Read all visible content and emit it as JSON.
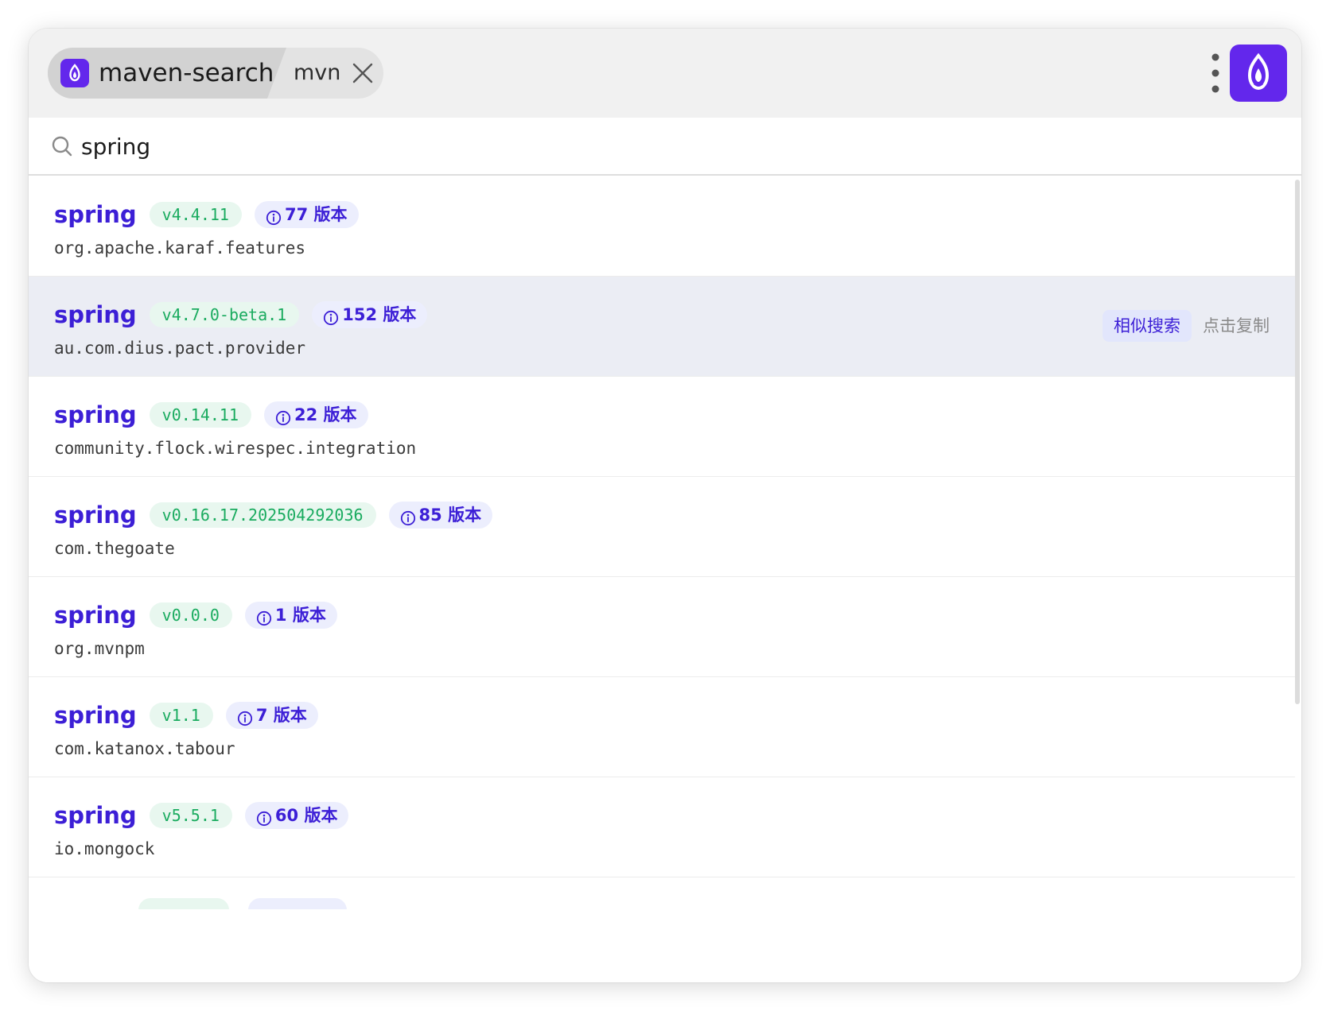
{
  "header": {
    "plugin_name": "maven-search",
    "plugin_keyword": "mvn",
    "plugin_icon": "flame-icon",
    "close_icon": "close-icon",
    "menu_icon": "kebab-menu-icon",
    "app_logo_icon": "flame-logo-icon"
  },
  "search": {
    "value": "spring",
    "icon": "search-icon"
  },
  "colors": {
    "accent": "#6327ec",
    "artifact_text": "#3c1fd6",
    "version_badge_bg": "#e8f7ef",
    "version_badge_text": "#1aab5f",
    "count_badge_bg": "#eceefd",
    "active_row_bg": "#ebedf4"
  },
  "results": [
    {
      "artifact": "spring",
      "version": "v4.4.11",
      "versions_count": "77 版本",
      "group": "org.apache.karaf.features"
    },
    {
      "artifact": "spring",
      "version": "v4.7.0-beta.1",
      "versions_count": "152 版本",
      "group": "au.com.dius.pact.provider"
    },
    {
      "artifact": "spring",
      "version": "v0.14.11",
      "versions_count": "22 版本",
      "group": "community.flock.wirespec.integration"
    },
    {
      "artifact": "spring",
      "version": "v0.16.17.202504292036",
      "versions_count": "85 版本",
      "group": "com.thegoate"
    },
    {
      "artifact": "spring",
      "version": "v0.0.0",
      "versions_count": "1 版本",
      "group": "org.mvnpm"
    },
    {
      "artifact": "spring",
      "version": "v1.1",
      "versions_count": "7 版本",
      "group": "com.katanox.tabour"
    },
    {
      "artifact": "spring",
      "version": "v5.5.1",
      "versions_count": "60 版本",
      "group": "io.mongock"
    }
  ],
  "row_actions": {
    "similar_search": "相似搜索",
    "click_copy": "点击复制"
  }
}
